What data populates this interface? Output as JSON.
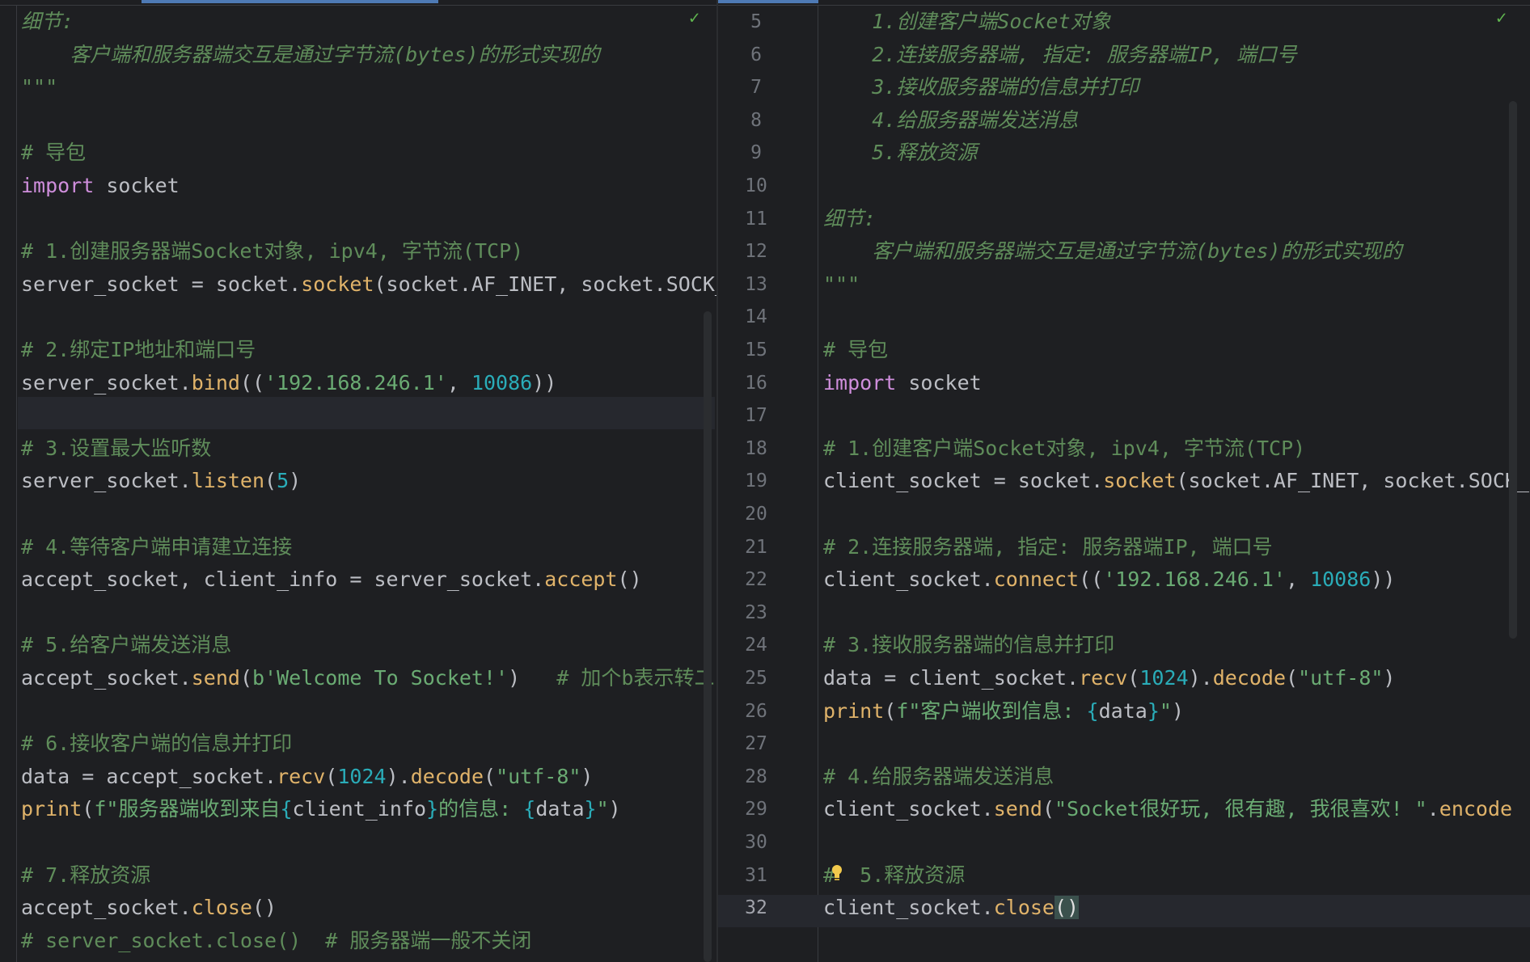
{
  "left_pane": {
    "status": "✓",
    "lines": [
      {
        "segs": [
          {
            "c": "it",
            "t": "细节:"
          }
        ]
      },
      {
        "segs": [
          {
            "c": "it",
            "t": "    客户端和服务器端交互是通过字节流(bytes)的形式实现的"
          }
        ]
      },
      {
        "segs": [
          {
            "c": "it",
            "t": "\"\"\""
          }
        ]
      },
      {
        "segs": []
      },
      {
        "segs": [
          {
            "c": "cm",
            "t": "# 导包"
          }
        ]
      },
      {
        "segs": [
          {
            "c": "kw",
            "t": "import"
          },
          {
            "c": "tx",
            "t": " socket"
          }
        ]
      },
      {
        "segs": []
      },
      {
        "segs": [
          {
            "c": "cm",
            "t": "# 1.创建服务器端Socket对象, ipv4, 字节流(TCP)"
          }
        ]
      },
      {
        "segs": [
          {
            "c": "tx",
            "t": "server_socket = socket."
          },
          {
            "c": "fn",
            "t": "socket"
          },
          {
            "c": "tx",
            "t": "(socket.AF_INET, socket.SOCK_"
          }
        ]
      },
      {
        "segs": []
      },
      {
        "segs": [
          {
            "c": "cm",
            "t": "# 2.绑定IP地址和端口号"
          }
        ]
      },
      {
        "segs": [
          {
            "c": "tx",
            "t": "server_socket."
          },
          {
            "c": "fn",
            "t": "bind"
          },
          {
            "c": "tx",
            "t": "(("
          },
          {
            "c": "str",
            "t": "'192.168.246.1'"
          },
          {
            "c": "tx",
            "t": ", "
          },
          {
            "c": "num",
            "t": "10086"
          },
          {
            "c": "tx",
            "t": "))"
          }
        ]
      },
      {
        "segs": []
      },
      {
        "segs": [
          {
            "c": "cm",
            "t": "# 3.设置最大监听数"
          }
        ]
      },
      {
        "segs": [
          {
            "c": "tx",
            "t": "server_socket."
          },
          {
            "c": "fn",
            "t": "listen"
          },
          {
            "c": "tx",
            "t": "("
          },
          {
            "c": "num",
            "t": "5"
          },
          {
            "c": "tx",
            "t": ")"
          }
        ]
      },
      {
        "segs": []
      },
      {
        "segs": [
          {
            "c": "cm",
            "t": "# 4.等待客户端申请建立连接"
          }
        ]
      },
      {
        "segs": [
          {
            "c": "tx",
            "t": "accept_socket, client_info = server_socket."
          },
          {
            "c": "fn",
            "t": "accept"
          },
          {
            "c": "tx",
            "t": "()"
          }
        ]
      },
      {
        "segs": []
      },
      {
        "segs": [
          {
            "c": "cm",
            "t": "# 5.给客户端发送消息"
          }
        ]
      },
      {
        "segs": [
          {
            "c": "tx",
            "t": "accept_socket."
          },
          {
            "c": "fn",
            "t": "send"
          },
          {
            "c": "tx",
            "t": "("
          },
          {
            "c": "str",
            "t": "b'Welcome To Socket!'"
          },
          {
            "c": "tx",
            "t": ")   "
          },
          {
            "c": "cm",
            "t": "# 加个b表示转二"
          }
        ]
      },
      {
        "segs": []
      },
      {
        "segs": [
          {
            "c": "cm",
            "t": "# 6.接收客户端的信息并打印"
          }
        ]
      },
      {
        "segs": [
          {
            "c": "tx",
            "t": "data = accept_socket."
          },
          {
            "c": "fn",
            "t": "recv"
          },
          {
            "c": "tx",
            "t": "("
          },
          {
            "c": "num",
            "t": "1024"
          },
          {
            "c": "tx",
            "t": ")."
          },
          {
            "c": "fn",
            "t": "decode"
          },
          {
            "c": "tx",
            "t": "("
          },
          {
            "c": "str",
            "t": "\"utf-8\""
          },
          {
            "c": "tx",
            "t": ")"
          }
        ]
      },
      {
        "segs": [
          {
            "c": "fn",
            "t": "print"
          },
          {
            "c": "tx",
            "t": "("
          },
          {
            "c": "str",
            "t": "f\"服务器端收到来自"
          },
          {
            "c": "num",
            "t": "{"
          },
          {
            "c": "tx",
            "t": "client_info"
          },
          {
            "c": "num",
            "t": "}"
          },
          {
            "c": "str",
            "t": "的信息: "
          },
          {
            "c": "num",
            "t": "{"
          },
          {
            "c": "tx",
            "t": "data"
          },
          {
            "c": "num",
            "t": "}"
          },
          {
            "c": "str",
            "t": "\""
          },
          {
            "c": "tx",
            "t": ")"
          }
        ]
      },
      {
        "segs": []
      },
      {
        "segs": [
          {
            "c": "cm",
            "t": "# 7.释放资源"
          }
        ]
      },
      {
        "segs": [
          {
            "c": "tx",
            "t": "accept_socket."
          },
          {
            "c": "fn",
            "t": "close"
          },
          {
            "c": "tx",
            "t": "()"
          }
        ]
      },
      {
        "segs": [
          {
            "c": "cm",
            "t": "# server_socket.close()  # 服务器端一般不关闭"
          }
        ]
      }
    ]
  },
  "right_pane": {
    "status": "✓",
    "line_numbers": [
      "5",
      "6",
      "7",
      "8",
      "9",
      "10",
      "11",
      "12",
      "13",
      "14",
      "15",
      "16",
      "17",
      "18",
      "19",
      "20",
      "21",
      "22",
      "23",
      "24",
      "25",
      "26",
      "27",
      "28",
      "29",
      "30",
      "31",
      "32"
    ],
    "lines": [
      {
        "segs": [
          {
            "c": "it",
            "t": "    1.创建客户端Socket对象"
          }
        ]
      },
      {
        "segs": [
          {
            "c": "it",
            "t": "    2.连接服务器端, 指定: 服务器端IP, 端口号"
          }
        ]
      },
      {
        "segs": [
          {
            "c": "it",
            "t": "    3.接收服务器端的信息并打印"
          }
        ]
      },
      {
        "segs": [
          {
            "c": "it",
            "t": "    4.给服务器端发送消息"
          }
        ]
      },
      {
        "segs": [
          {
            "c": "it",
            "t": "    5.释放资源"
          }
        ]
      },
      {
        "segs": []
      },
      {
        "segs": [
          {
            "c": "it",
            "t": "细节:"
          }
        ]
      },
      {
        "segs": [
          {
            "c": "it",
            "t": "    客户端和服务器端交互是通过字节流(bytes)的形式实现的"
          }
        ]
      },
      {
        "segs": [
          {
            "c": "it",
            "t": "\"\"\""
          }
        ]
      },
      {
        "segs": []
      },
      {
        "segs": [
          {
            "c": "cm",
            "t": "# 导包"
          }
        ]
      },
      {
        "segs": [
          {
            "c": "kw",
            "t": "import"
          },
          {
            "c": "tx",
            "t": " socket"
          }
        ]
      },
      {
        "segs": []
      },
      {
        "segs": [
          {
            "c": "cm",
            "t": "# 1.创建客户端Socket对象, ipv4, 字节流(TCP)"
          }
        ]
      },
      {
        "segs": [
          {
            "c": "tx",
            "t": "client_socket = socket."
          },
          {
            "c": "fn",
            "t": "socket"
          },
          {
            "c": "tx",
            "t": "(socket.AF_INET, socket.SOCK_"
          }
        ]
      },
      {
        "segs": []
      },
      {
        "segs": [
          {
            "c": "cm",
            "t": "# 2.连接服务器端, 指定: 服务器端IP, 端口号"
          }
        ]
      },
      {
        "segs": [
          {
            "c": "tx",
            "t": "client_socket."
          },
          {
            "c": "fn",
            "t": "connect"
          },
          {
            "c": "tx",
            "t": "(("
          },
          {
            "c": "str",
            "t": "'192.168.246.1'"
          },
          {
            "c": "tx",
            "t": ", "
          },
          {
            "c": "num",
            "t": "10086"
          },
          {
            "c": "tx",
            "t": "))"
          }
        ]
      },
      {
        "segs": []
      },
      {
        "segs": [
          {
            "c": "cm",
            "t": "# 3.接收服务器端的信息并打印"
          }
        ]
      },
      {
        "segs": [
          {
            "c": "tx",
            "t": "data = client_socket."
          },
          {
            "c": "fn",
            "t": "recv"
          },
          {
            "c": "tx",
            "t": "("
          },
          {
            "c": "num",
            "t": "1024"
          },
          {
            "c": "tx",
            "t": ")."
          },
          {
            "c": "fn",
            "t": "decode"
          },
          {
            "c": "tx",
            "t": "("
          },
          {
            "c": "str",
            "t": "\"utf-8\""
          },
          {
            "c": "tx",
            "t": ")"
          }
        ]
      },
      {
        "segs": [
          {
            "c": "fn",
            "t": "print"
          },
          {
            "c": "tx",
            "t": "("
          },
          {
            "c": "str",
            "t": "f\"客户端收到信息: "
          },
          {
            "c": "num",
            "t": "{"
          },
          {
            "c": "tx",
            "t": "data"
          },
          {
            "c": "num",
            "t": "}"
          },
          {
            "c": "str",
            "t": "\""
          },
          {
            "c": "tx",
            "t": ")"
          }
        ]
      },
      {
        "segs": []
      },
      {
        "segs": [
          {
            "c": "cm",
            "t": "# 4.给服务器端发送消息"
          }
        ]
      },
      {
        "segs": [
          {
            "c": "tx",
            "t": "client_socket."
          },
          {
            "c": "fn",
            "t": "send"
          },
          {
            "c": "tx",
            "t": "("
          },
          {
            "c": "str",
            "t": "\"Socket很好玩, 很有趣, 我很喜欢! \""
          },
          {
            "c": "tx",
            "t": "."
          },
          {
            "c": "fn",
            "t": "encode"
          }
        ]
      },
      {
        "segs": []
      },
      {
        "segs": [
          {
            "c": "cm",
            "t": "#  5.释放资源"
          }
        ]
      },
      {
        "segs": [
          {
            "c": "tx",
            "t": "client_socket."
          },
          {
            "c": "fn",
            "t": "close"
          },
          {
            "c": "hl",
            "t": "()"
          }
        ]
      }
    ]
  },
  "colors": {
    "background": "#1e1f22",
    "keyword": "#cf8edc",
    "comment": "#5f8c5a",
    "string": "#6aab73",
    "number": "#2aacb8",
    "function": "#e0b36a",
    "text": "#bcbec4",
    "tab_accent": "#4e7ab5"
  },
  "icons": {
    "status_ok": "check-icon",
    "intention": "lightbulb-icon"
  }
}
